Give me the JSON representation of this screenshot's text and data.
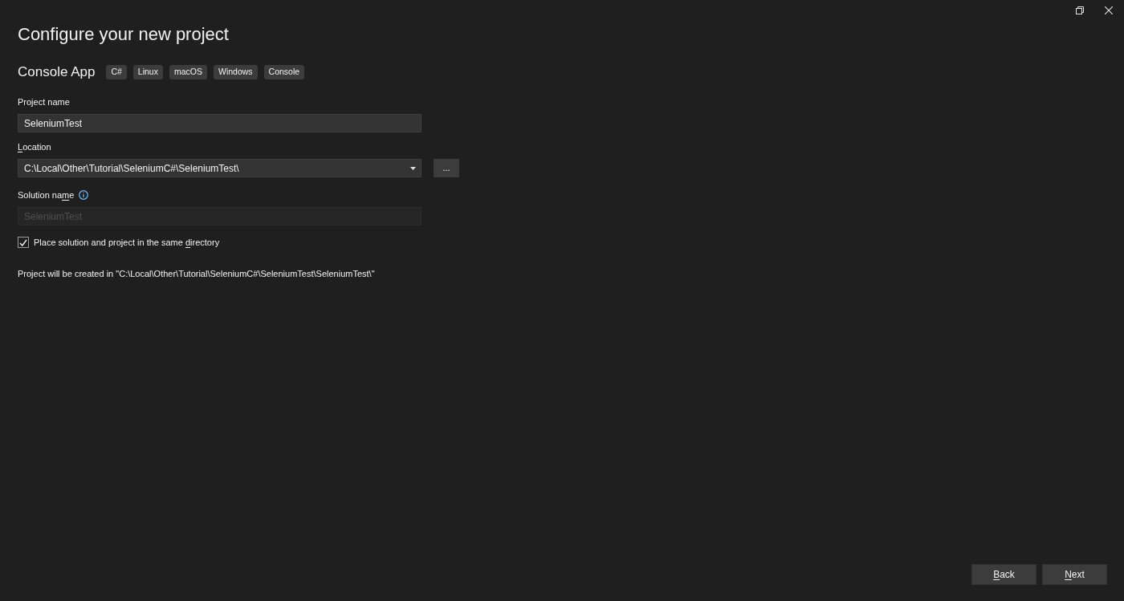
{
  "title": "Configure your new project",
  "template": {
    "name": "Console App",
    "tags": [
      "C#",
      "Linux",
      "macOS",
      "Windows",
      "Console"
    ]
  },
  "fields": [
    {
      "kind": "text",
      "label": {
        "post": "Project name"
      },
      "value": "SeleniumTest",
      "disabled": false
    },
    {
      "kind": "combo",
      "label": {
        "access_key": "L",
        "post": "ocation"
      },
      "value": "C:\\Local\\Other\\Tutorial\\SeleniumC#\\SeleniumTest\\",
      "browse": "...",
      "disabled": false
    },
    {
      "kind": "text",
      "label": {
        "pre": "Solution na",
        "access_key": "m",
        "post": "e"
      },
      "info": true,
      "value": "SeleniumTest",
      "disabled": true
    }
  ],
  "same_directory": {
    "label": {
      "pre": "Place solution and project in the same ",
      "access_key": "d",
      "post": "irectory"
    },
    "checked": true
  },
  "path_note": "Project will be created in \"C:\\Local\\Other\\Tutorial\\SeleniumC#\\SeleniumTest\\SeleniumTest\\\"",
  "buttons": [
    {
      "label": {
        "access_key": "B",
        "post": "ack"
      }
    },
    {
      "label": {
        "access_key": "N",
        "post": "ext"
      }
    }
  ]
}
